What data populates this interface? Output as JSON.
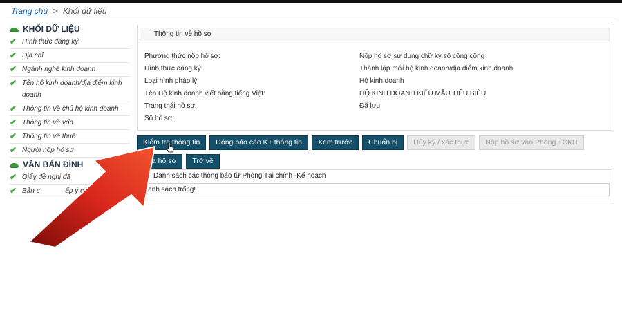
{
  "breadcrumb": {
    "home": "Trang chủ",
    "separator": ">",
    "current": "Khối dữ liệu"
  },
  "sidebar": {
    "section1": "KHỐI DỮ LIỆU",
    "items1": [
      "Hình thức đăng ký",
      "Địa chỉ",
      "Ngành nghề kinh doanh",
      "Tên hộ kinh doanh/địa điểm kinh doanh",
      "Thông tin về chủ hộ kinh doanh",
      "Thông tin về vốn",
      "Thông tin về thuế",
      "Người nộp hồ sơ"
    ],
    "section2": "VĂN BẢN ĐÍNH",
    "plus": "+",
    "items2": [
      "Giấy đề nghị đă",
      "Bản s",
      "ấp ý của cá nhân"
    ]
  },
  "info": {
    "title": "Thông tin về hồ sơ",
    "rows": [
      {
        "label": "Phương thức nộp hồ sơ:",
        "value": "Nộp hồ sơ sử dụng chữ ký số công cộng"
      },
      {
        "label": "Hình thức đăng ký:",
        "value": "Thành lập mới hộ kinh doanh/địa điểm kinh doanh"
      },
      {
        "label": "Loại hình pháp lý:",
        "value": "Hộ kinh doanh"
      },
      {
        "label": "Tên Hộ kinh doanh viết bằng tiếng Việt:",
        "value": "HỘ KINH DOANH KIỂU MẪU TIÊU BIỂU"
      },
      {
        "label": "Trạng thái hồ sơ:",
        "value": "Đã lưu"
      },
      {
        "label": "Số hồ sơ:",
        "value": ""
      }
    ]
  },
  "buttons": {
    "check": "Kiểm tra thông tin",
    "report": "Đóng báo cáo KT thông tin",
    "preview": "Xem trước",
    "prepare": "Chuẩn bị",
    "cancel_sign": "Hủy ký / xác thực",
    "submit": "Nộp hồ sơ vào Phòng TCKH",
    "delete": "Xóa hồ sơ",
    "back": "Trở về"
  },
  "notifications": {
    "title": "Danh sách các thông báo từ Phòng Tài chính -Kế hoạch",
    "empty": "Danh sách trống!"
  },
  "colors": {
    "button_bg": "#15506a",
    "check_green": "#3fa93f",
    "arrow_red": "#d8261c"
  }
}
